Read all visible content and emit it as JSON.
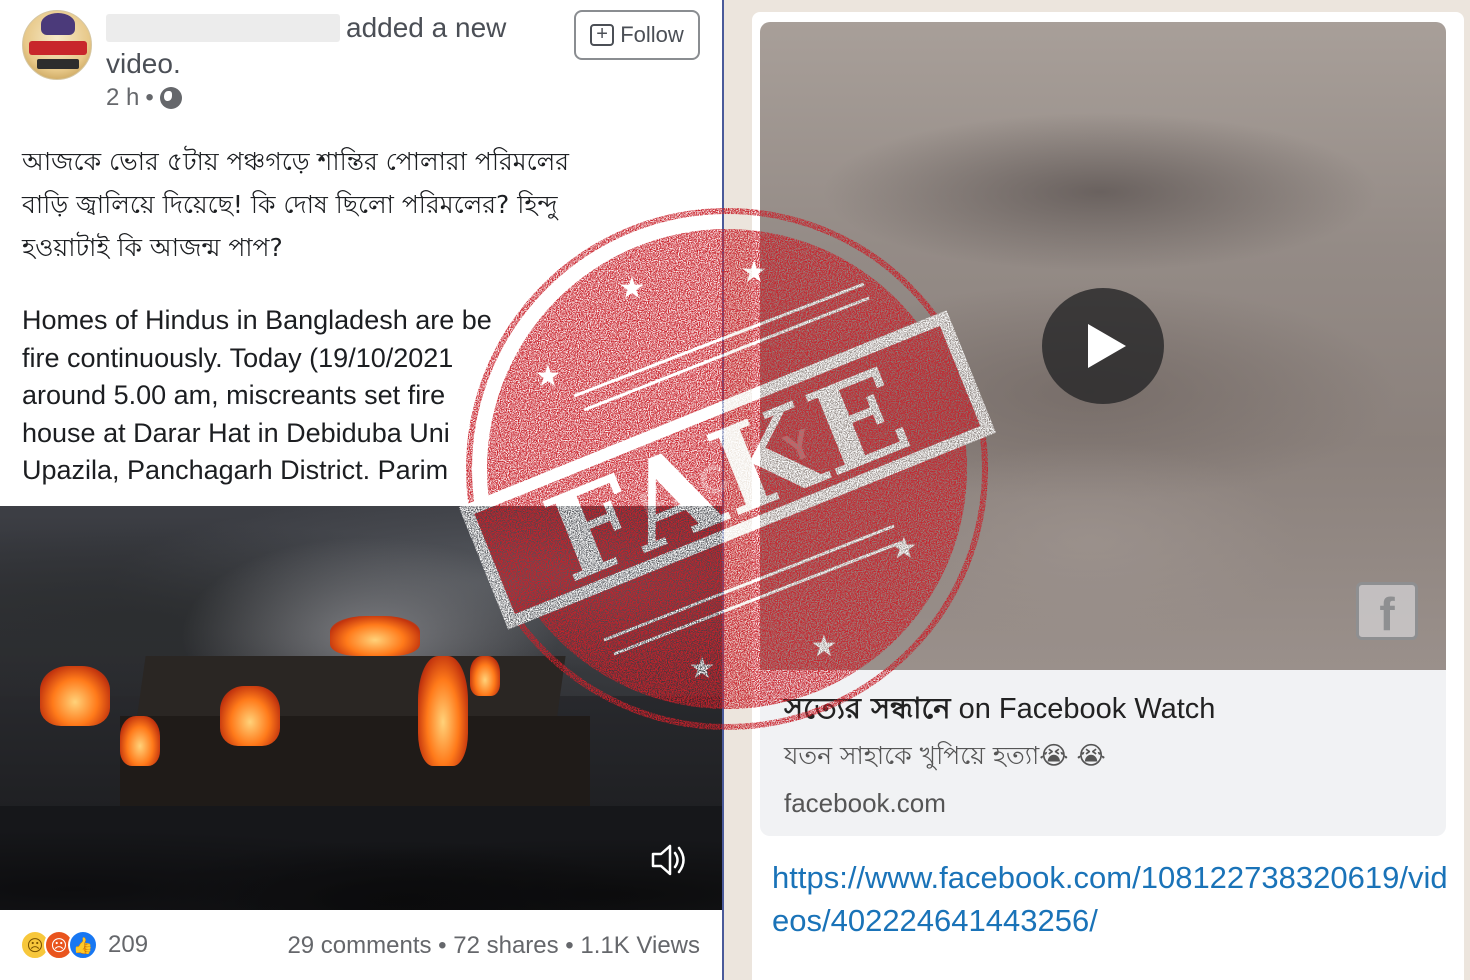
{
  "post": {
    "header_action": "added a new",
    "header_action_2": "video.",
    "time": "2 h",
    "dot": "•",
    "follow_label": "Follow",
    "body_bn_lines": [
      "আজকে ভোর ৫টায় পঞ্চগড়ে শান্তির পোলারা পরিমলের",
      "বাড়ি জ্বালিয়ে দিয়েছে! কি দোষ ছিলো পরিমলের? হিন্দু",
      "হওয়াটাই কি আজন্ম পাপ?"
    ],
    "body_en_lines": [
      "Homes of Hindus in Bangladesh are be",
      "fire continuously. Today (19/10/2021",
      "around 5.00 am, miscreants set fire",
      "house at Darar Hat in Debiduba Uni",
      "Upazila, Panchagarh District. Parim"
    ],
    "reaction_count": "209",
    "stats": "29 comments • 72 shares • 1.1K Views",
    "icons": [
      "globe-icon",
      "follow-icon",
      "speaker-icon",
      "sad-reaction-icon",
      "angry-reaction-icon",
      "like-reaction-icon"
    ]
  },
  "preview": {
    "title_bn": "সত্যের সন্ধানে",
    "title_en": " on Facebook Watch",
    "desc": "যতন সাহাকে খুপিয়ে হত্যা😭 😭",
    "domain": "facebook.com",
    "badge": "f",
    "link": "https://www.facebook.com/108122738320619/videos/402224641443256/",
    "icons": [
      "play-icon",
      "facebook-icon"
    ]
  },
  "stamp": {
    "text": "FAKE",
    "watermark": "FACTLY",
    "color": "#c8202a"
  }
}
